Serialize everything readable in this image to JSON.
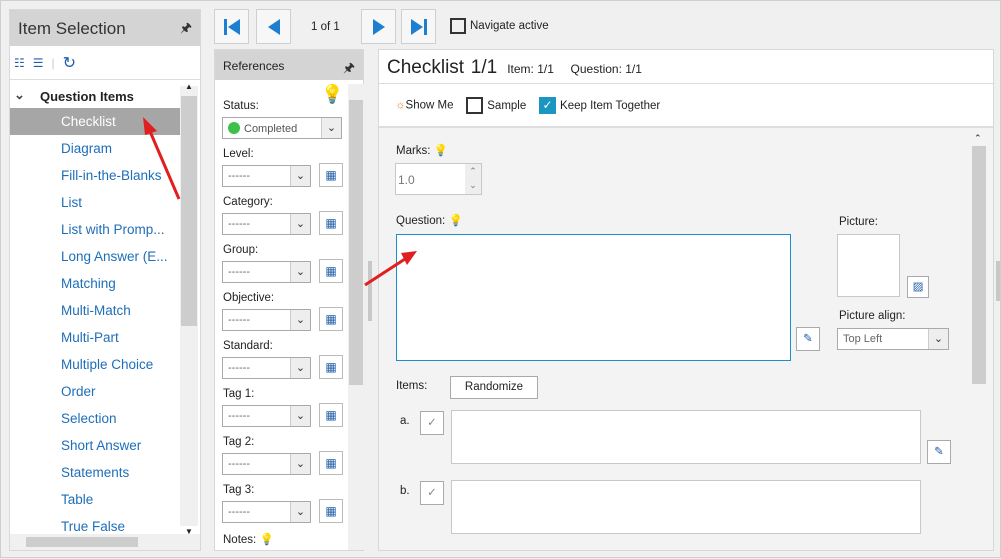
{
  "item_selection": {
    "title": "Item Selection",
    "group": "Question Items",
    "items": [
      "Checklist",
      "Diagram",
      "Fill-in-the-Blanks",
      "List",
      "List with Promp...",
      "Long Answer (E...",
      "Matching",
      "Multi-Match",
      "Multi-Part",
      "Multiple Choice",
      "Order",
      "Selection",
      "Short Answer",
      "Statements",
      "Table",
      "True False"
    ],
    "selected": "Checklist"
  },
  "nav": {
    "page": "1 of 1",
    "navigate_active": "Navigate active"
  },
  "references": {
    "title": "References",
    "status_label": "Status:",
    "status_value": "Completed",
    "fields": [
      {
        "label": "Level:",
        "value": "------"
      },
      {
        "label": "Category:",
        "value": "------"
      },
      {
        "label": "Group:",
        "value": "------"
      },
      {
        "label": "Objective:",
        "value": "------"
      },
      {
        "label": "Standard:",
        "value": "------"
      },
      {
        "label": "Tag 1:",
        "value": "------"
      },
      {
        "label": "Tag 2:",
        "value": "------"
      },
      {
        "label": "Tag 3:",
        "value": "------"
      }
    ],
    "notes_label": "Notes:"
  },
  "main": {
    "title": "Checklist",
    "count": "1/1",
    "item": "Item: 1/1",
    "question": "Question: 1/1",
    "show_me": "Show Me",
    "sample": "Sample",
    "keep_together": "Keep Item Together",
    "marks_label": "Marks:",
    "marks_value": "1.0",
    "question_label": "Question:",
    "picture_label": "Picture:",
    "picture_align_label": "Picture align:",
    "picture_align_value": "Top Left",
    "items_label": "Items:",
    "randomize": "Randomize",
    "item_a": "a.",
    "item_b": "b."
  },
  "colors": {
    "accent": "#1e6eb8",
    "status": "#3cc24a",
    "arrow": "#e02020"
  }
}
